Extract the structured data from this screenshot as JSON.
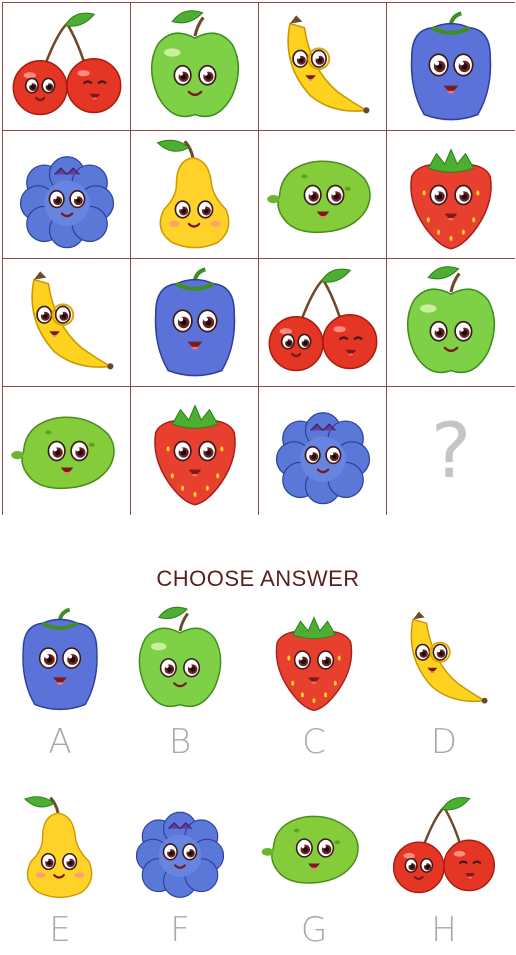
{
  "grid": {
    "cells": [
      {
        "fruit": "cherry-icon"
      },
      {
        "fruit": "apple-icon"
      },
      {
        "fruit": "banana-icon"
      },
      {
        "fruit": "pepper-icon"
      },
      {
        "fruit": "blueberry-icon"
      },
      {
        "fruit": "pear-icon"
      },
      {
        "fruit": "lime-icon"
      },
      {
        "fruit": "strawberry-icon"
      },
      {
        "fruit": "banana-icon"
      },
      {
        "fruit": "pepper-icon"
      },
      {
        "fruit": "cherry-icon"
      },
      {
        "fruit": "apple-icon"
      },
      {
        "fruit": "lime-icon"
      },
      {
        "fruit": "strawberry-icon"
      },
      {
        "fruit": "blueberry-icon"
      },
      {
        "fruit": "question-mark"
      }
    ],
    "question_mark": "?"
  },
  "choose_title": "CHOOSE ANSWER",
  "answers": [
    {
      "letter": "A",
      "fruit": "pepper-icon"
    },
    {
      "letter": "B",
      "fruit": "apple-icon"
    },
    {
      "letter": "C",
      "fruit": "strawberry-icon"
    },
    {
      "letter": "D",
      "fruit": "banana-icon"
    },
    {
      "letter": "E",
      "fruit": "pear-icon"
    },
    {
      "letter": "F",
      "fruit": "blueberry-icon"
    },
    {
      "letter": "G",
      "fruit": "lime-icon"
    },
    {
      "letter": "H",
      "fruit": "cherry-icon"
    }
  ],
  "colors": {
    "grid_line": "#8a4a4a",
    "title": "#5b1f1f",
    "letters": "#a9a9a9",
    "question_mark": "#c4c4c4"
  }
}
